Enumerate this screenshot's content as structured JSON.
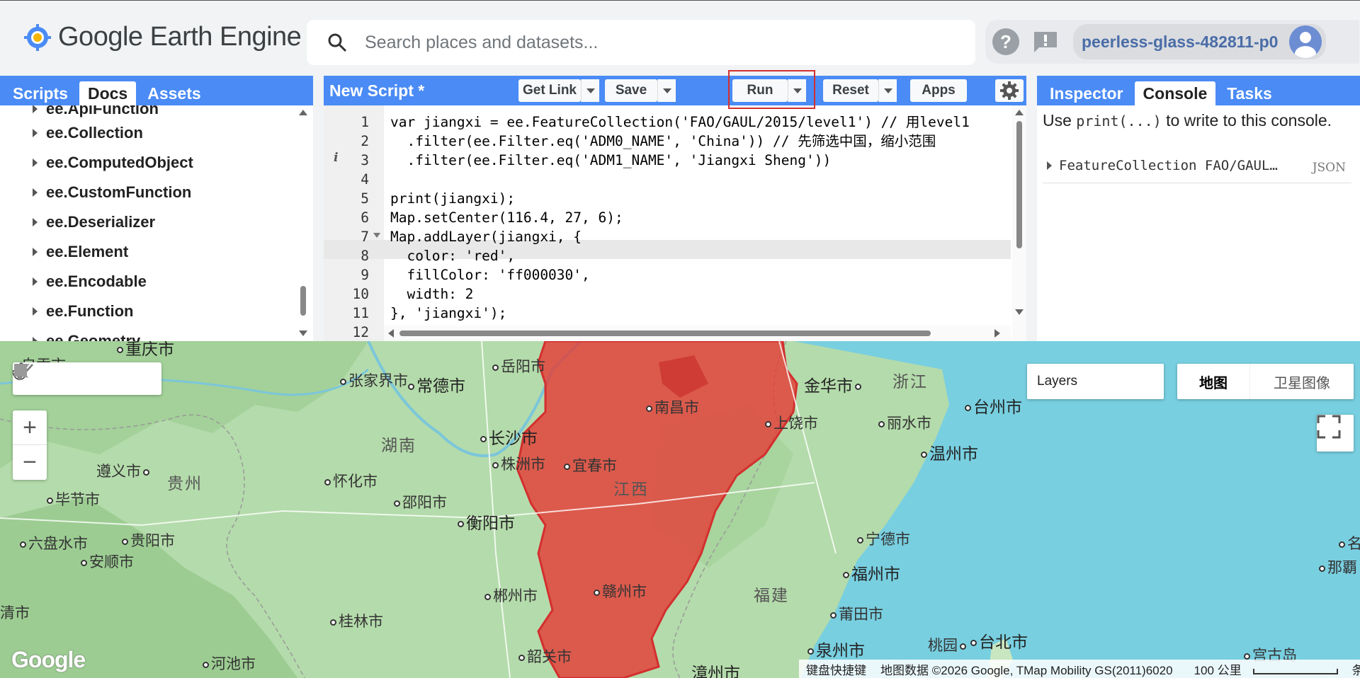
{
  "header": {
    "app_title": "Google Earth Engine",
    "search_placeholder": "Search places and datasets...",
    "help_icon": "help-icon",
    "feedback_icon": "feedback-icon",
    "project": "peerless-glass-482811-p0"
  },
  "left_panel": {
    "tabs": [
      "Scripts",
      "Docs",
      "Assets"
    ],
    "active_tab": "Docs",
    "tree_items": [
      "ee.ApiFunction",
      "ee.Collection",
      "ee.ComputedObject",
      "ee.CustomFunction",
      "ee.Deserializer",
      "ee.Element",
      "ee.Encodable",
      "ee.Function",
      "ee.Geometry"
    ]
  },
  "editor": {
    "script_title": "New Script *",
    "buttons": {
      "get_link": "Get Link",
      "save": "Save",
      "run": "Run",
      "reset": "Reset",
      "apps": "Apps"
    },
    "line_numbers": [
      "1",
      "2",
      "3",
      "4",
      "5",
      "6",
      "7",
      "8",
      "9",
      "10",
      "11",
      "12"
    ],
    "code_lines": [
      "var jiangxi = ee.FeatureCollection('FAO/GAUL/2015/level1') // 用level1",
      "  .filter(ee.Filter.eq('ADM0_NAME', 'China')) // 先筛选中国，缩小范围",
      "  .filter(ee.Filter.eq('ADM1_NAME', 'Jiangxi Sheng'))",
      "",
      "print(jiangxi);",
      "Map.setCenter(116.4, 27, 6);",
      "Map.addLayer(jiangxi, {",
      "  color: 'red',",
      "  fillColor: 'ff000030',",
      "  width: 2",
      "}, 'jiangxi');",
      ""
    ],
    "active_line": "8"
  },
  "right_panel": {
    "tabs": [
      "Inspector",
      "Console",
      "Tasks"
    ],
    "active_tab": "Console",
    "hint_pre": "Use",
    "hint_code": "print(...)",
    "hint_post": "to write to this console.",
    "entry_text": "FeatureCollection FAO/GAUL…",
    "entry_badge": "JSON"
  },
  "map": {
    "layers_label": "Layers",
    "map_type_options": [
      "地图",
      "卫星图像"
    ],
    "active_map_type": "地图",
    "highlight_color": "#e53935",
    "attribution": [
      "键盘快捷键",
      "地图数据 ©2026 Google, TMap Mobility GS(2011)6020",
      "100 公里",
      "条款"
    ],
    "logo": "Google",
    "labels": {
      "yueyang": "岳阳市",
      "changde": "常德市",
      "zhangjiajie": "张家界市",
      "chongqing": "重庆市",
      "zigong": "自贡市",
      "changsha": "长沙市",
      "hunan": "湖南",
      "zhuzhou": "株洲市",
      "zunyi": "遵义市",
      "guizhou": "贵州",
      "huaihua": "怀化市",
      "bijie": "毕节市",
      "shaoyang": "邵阳市",
      "hengyang": "衡阳市",
      "liupanshui": "六盘水市",
      "guiyang": "贵阳市",
      "anshun": "安顺市",
      "chenzhou": "郴州市",
      "guilin": "桂林市",
      "hechi": "河池市",
      "shaoguan": "韶关市",
      "nanchang": "南昌市",
      "yichun": "宜春市",
      "jiangxi": "江西",
      "ganzhou": "赣州市",
      "shangrao": "上饶市",
      "jinhua": "金华市",
      "zhejiang": "浙江",
      "taizhou": "台州市",
      "lishui": "丽水市",
      "wenzhou": "温州市",
      "ningde": "宁德市",
      "fuzhou": "福州市",
      "fujian": "福建",
      "putian": "莆田市",
      "quanzhou": "泉州市",
      "zhangzhou": "漳州市",
      "taibei": "台北市",
      "taoyuan": "桃园",
      "gongu": "宫古岛",
      "naba": "那覇",
      "ming": "名",
      "qing": "清市"
    }
  }
}
